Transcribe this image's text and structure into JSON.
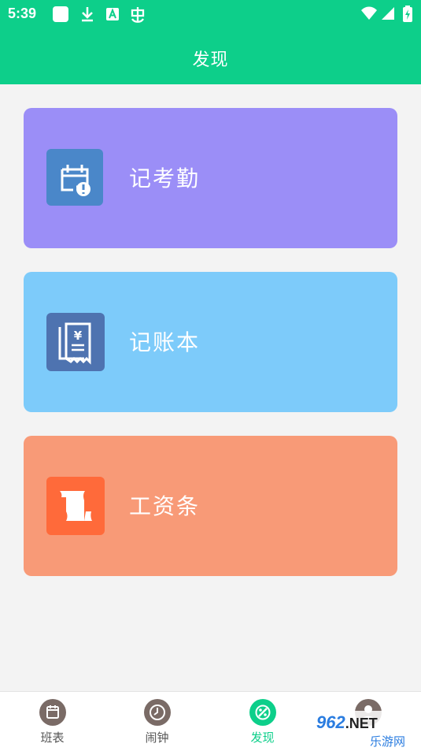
{
  "status_bar": {
    "time": "5:39",
    "left_icons": [
      "app-icon",
      "download-icon",
      "a-icon",
      "bug-icon"
    ],
    "right_icons": [
      "wifi-icon",
      "signal-icon",
      "battery-icon"
    ]
  },
  "header": {
    "title": "发现"
  },
  "cards": [
    {
      "label": "记考勤",
      "icon": "attendance-calendar-icon",
      "bg_color": "#9b8ef7",
      "icon_color": "#4a87c9"
    },
    {
      "label": "记账本",
      "icon": "ledger-receipt-icon",
      "bg_color": "#7dcbfa",
      "icon_color": "#4e73b0"
    },
    {
      "label": "工资条",
      "icon": "payslip-scroll-icon",
      "bg_color": "#f89a77",
      "icon_color": "#ff6a3a"
    }
  ],
  "tabs": [
    {
      "label": "班表",
      "icon": "schedule-icon",
      "active": false
    },
    {
      "label": "闹钟",
      "icon": "clock-icon",
      "active": false
    },
    {
      "label": "发现",
      "icon": "discover-icon",
      "active": true
    },
    {
      "label": "",
      "icon": "profile-icon",
      "active": false
    }
  ],
  "colors": {
    "primary": "#0dcf8a",
    "background": "#f3f3f3",
    "tab_inactive": "#7a6b66"
  },
  "watermark": {
    "number": "962",
    "suffix": ".NET",
    "text": "乐游网"
  }
}
